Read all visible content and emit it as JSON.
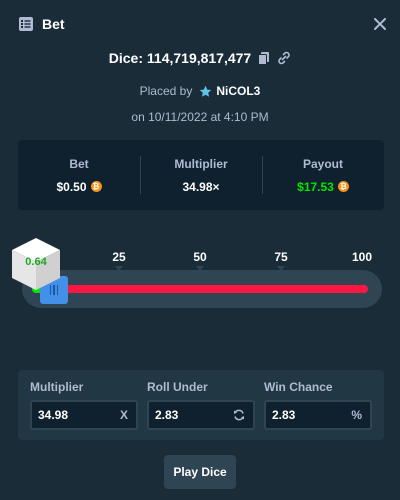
{
  "header": {
    "title": "Bet",
    "title_icon": "bet-slip-icon",
    "close_icon": "close-icon"
  },
  "dice": {
    "label": "Dice: 114,719,817,477",
    "copy_icon": "copy-icon",
    "link_icon": "link-icon"
  },
  "placed": {
    "prefix": "Placed by",
    "user": "NiCOL3",
    "user_icon": "star-badge-icon"
  },
  "date": "on 10/11/2022 at 4:10 PM",
  "stats": {
    "bet_label": "Bet",
    "bet_value": "$0.50",
    "multiplier_label": "Multiplier",
    "multiplier_value": "34.98×",
    "payout_label": "Payout",
    "payout_value": "$17.53",
    "currency_icon": "bitcoin-icon"
  },
  "slider": {
    "ticks": [
      "25",
      "50",
      "75",
      "100"
    ],
    "result": "0.64",
    "roll_under_value": 2.83,
    "colors": {
      "win": "#00e701",
      "lose": "#ff1744",
      "handle": "#4390e8"
    }
  },
  "inputs": {
    "multiplier_label": "Multiplier",
    "multiplier_value": "34.98",
    "multiplier_suffix": "X",
    "roll_under_label": "Roll Under",
    "roll_under_value": "2.83",
    "roll_under_icon": "refresh-icon",
    "win_chance_label": "Win Chance",
    "win_chance_value": "2.83",
    "win_chance_suffix": "%"
  },
  "play_button": "Play Dice"
}
